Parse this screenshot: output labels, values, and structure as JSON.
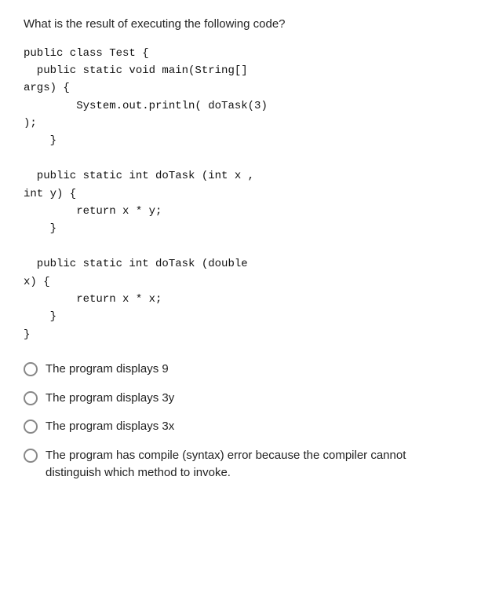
{
  "question": {
    "text": "What is the result of executing the following code?"
  },
  "code": {
    "lines": "public class Test {\n  public static void main(String[]\nargs) {\n        System.out.println( doTask(3)\n);\n    }\n\n  public static int doTask (int x ,\nint y) {\n        return x * y;\n    }\n\n  public static int doTask (double\nx) {\n        return x * x;\n    }\n}"
  },
  "options": [
    {
      "id": "opt1",
      "label": "The program displays 9"
    },
    {
      "id": "opt2",
      "label": "The program displays 3y"
    },
    {
      "id": "opt3",
      "label": "The program displays 3x"
    },
    {
      "id": "opt4",
      "label": "The program has compile (syntax) error because the compiler cannot distinguish which method to invoke."
    }
  ]
}
